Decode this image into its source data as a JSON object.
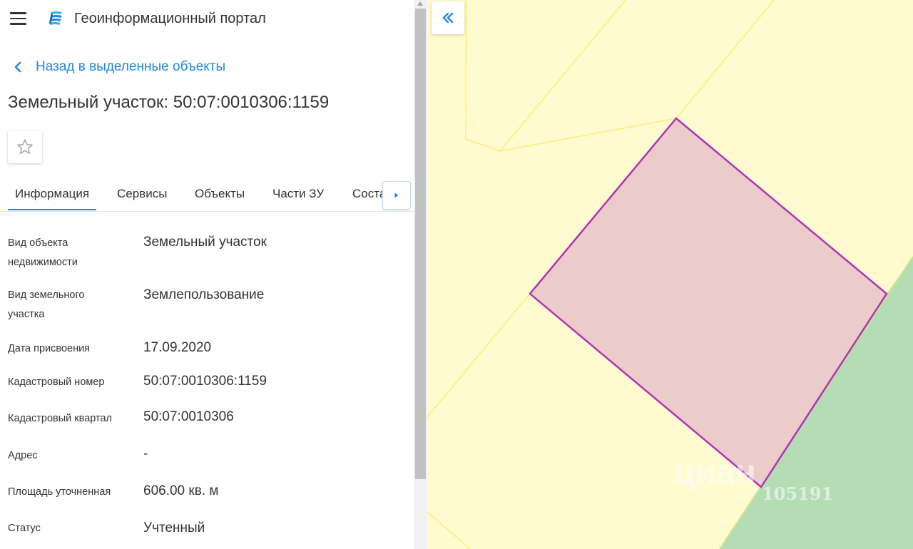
{
  "header": {
    "app_title": "Геоинформационный портал"
  },
  "nav": {
    "back_label": "Назад в выделенные объекты"
  },
  "object": {
    "title": "Земельный участок: 50:07:0010306:1159"
  },
  "tabs": [
    {
      "label": "Информация",
      "active": true
    },
    {
      "label": "Сервисы",
      "active": false
    },
    {
      "label": "Объекты",
      "active": false
    },
    {
      "label": "Части ЗУ",
      "active": false
    },
    {
      "label": "Соста",
      "active": false
    }
  ],
  "info": [
    {
      "label": "Вид объекта недвижимости",
      "value": "Земельный участок"
    },
    {
      "label": "Вид земельного участка",
      "value": "Землепользование"
    },
    {
      "label": "Дата присвоения",
      "value": "17.09.2020"
    },
    {
      "label": "Кадастровый номер",
      "value": "50:07:0010306:1159"
    },
    {
      "label": "Кадастровый квартал",
      "value": "50:07:0010306"
    },
    {
      "label": "Адрес",
      "value": "-"
    },
    {
      "label": "Площадь уточненная",
      "value": "606.00 кв. м"
    },
    {
      "label": "Статус",
      "value": "Учтенный"
    }
  ],
  "icons": {
    "menu": "menu-icon",
    "logo": "logo-icon",
    "back": "chevron-left-icon",
    "favorite": "star-icon",
    "tabs_scroll": "caret-right-icon",
    "collapse": "double-chevron-left-icon"
  },
  "map": {
    "watermark": "циан",
    "watermark_id": "105191"
  },
  "colors": {
    "accent": "#1e88e5",
    "map_background": "#fffacf",
    "parcel_border": "#fff08a",
    "selected_fill": "#ecccca",
    "selected_border": "#b033b8",
    "green_zone": "#b4ddb5"
  }
}
